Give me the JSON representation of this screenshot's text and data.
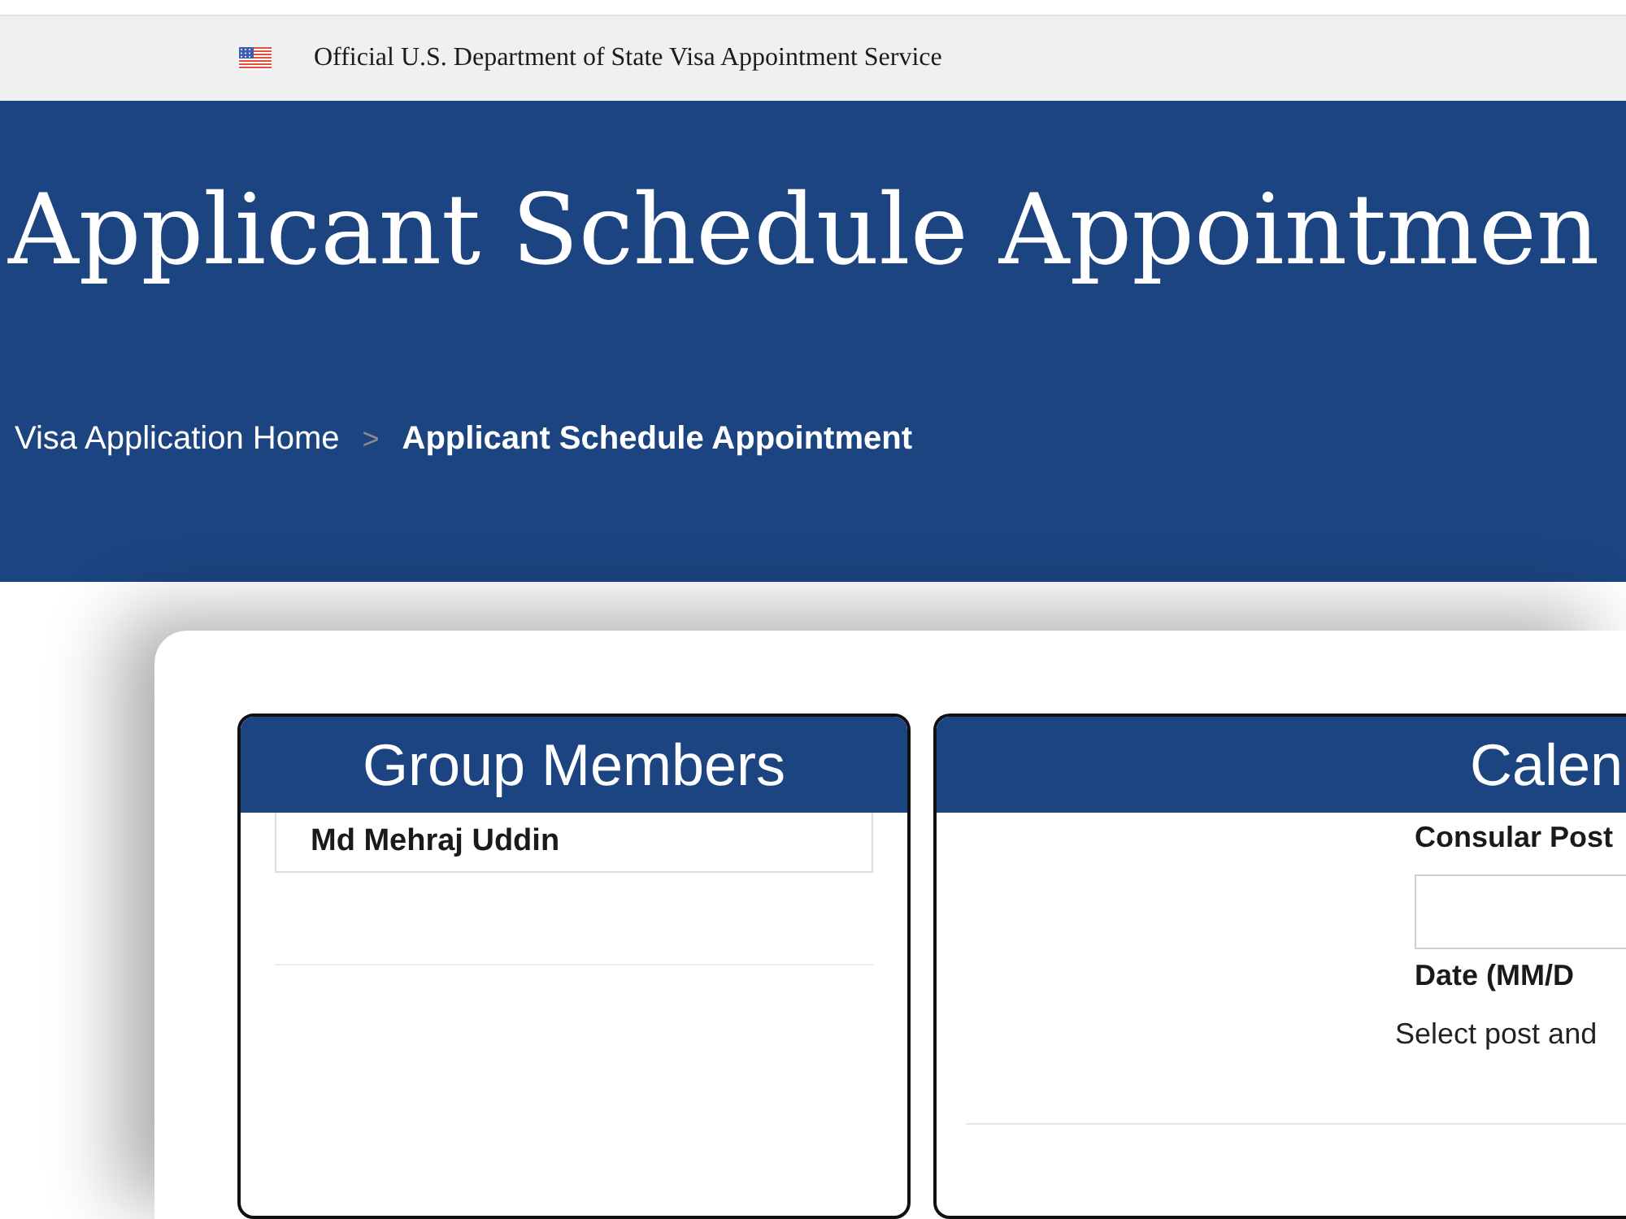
{
  "gov_banner": {
    "text": "Official U.S. Department of State Visa Appointment Service"
  },
  "header": {
    "title": "Applicant Schedule Appointmen",
    "breadcrumb": {
      "separator": ">",
      "items": [
        {
          "label": "Visa Application Home",
          "current": false
        },
        {
          "label": "Applicant Schedule Appointment",
          "current": true
        }
      ]
    }
  },
  "group_members": {
    "title": "Group Members",
    "members": [
      {
        "name": "Md Mehraj Uddin"
      }
    ]
  },
  "calendar": {
    "title": "Calen",
    "consular_post": {
      "label": "Consular Post"
    },
    "date": {
      "label": "Date (MM/D"
    },
    "hint": "Select post and"
  }
}
